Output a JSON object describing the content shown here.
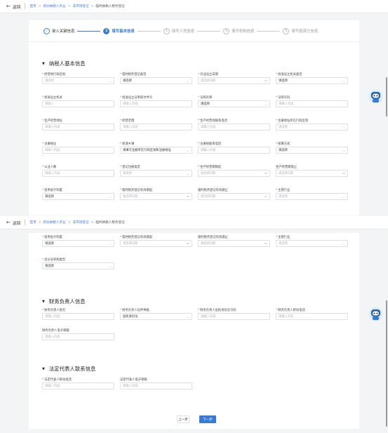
{
  "nav": {
    "back": "返回",
    "crumbs": [
      "首页",
      "新办纳税人开业",
      "非市场登记"
    ],
    "current": "临时纳税人税务登记"
  },
  "steps": [
    {
      "n": "✓",
      "label": "录入关键信息",
      "state": "done"
    },
    {
      "n": "2",
      "label": "填写基本信息",
      "state": "active"
    },
    {
      "n": "3",
      "label": "填写人员信息",
      "state": "todo"
    },
    {
      "n": "4",
      "label": "填写机构信息",
      "state": "todo"
    },
    {
      "n": "5",
      "label": "填写投资方信息",
      "state": "todo"
    }
  ],
  "section1": {
    "title": "纳税人基本信息"
  },
  "fields": [
    {
      "label": "经营地行政区划",
      "req": true,
      "value": "请选择",
      "kind": "select",
      "filled": false
    },
    {
      "label": "临时税务登记类型",
      "req": true,
      "value": "请选择",
      "kind": "select",
      "filled": true
    },
    {
      "label": "开业设立日期",
      "req": true,
      "value": "请选择日期",
      "kind": "date",
      "filled": false
    },
    {
      "label": "批准设立机关类型",
      "req": true,
      "value": "请选择",
      "kind": "select",
      "filled": true
    },
    {
      "label": "批准设立机关",
      "req": true,
      "value": "请输入",
      "kind": "text",
      "filled": false
    },
    {
      "label": "批准设立证明或文件号",
      "req": true,
      "value": "请输入内容",
      "kind": "text",
      "filled": false
    },
    {
      "label": "证照名称",
      "req": true,
      "value": "请选择",
      "kind": "select",
      "filled": true
    },
    {
      "label": "证照号码",
      "req": true,
      "value": "请输入内容",
      "kind": "text",
      "filled": false
    },
    {
      "label": "生产经营地址",
      "req": true,
      "value": "请输入内容",
      "kind": "text",
      "filled": false
    },
    {
      "label": "经营范围",
      "req": true,
      "value": "请输入内容",
      "kind": "text",
      "filled": false
    },
    {
      "label": "生产经营地联系电话",
      "req": true,
      "value": "请输入内容",
      "kind": "text",
      "filled": false
    },
    {
      "label": "注册地址所在行政区划",
      "req": true,
      "value": "请选择",
      "kind": "select",
      "filled": false
    },
    {
      "label": "注册地址",
      "req": true,
      "value": "请输入内容",
      "kind": "text",
      "filled": false
    },
    {
      "label": "街道乡镇",
      "req": true,
      "value": "请填写注册所在行政区划和注册地址",
      "kind": "select",
      "filled": true
    },
    {
      "label": "注册地联系电话",
      "req": true,
      "value": "请输入内容",
      "kind": "text",
      "filled": false
    },
    {
      "label": "核算方式",
      "req": true,
      "value": "请选择",
      "kind": "select",
      "filled": true
    },
    {
      "label": "从业人数",
      "req": true,
      "value": "请输入内容",
      "kind": "text",
      "filled": false
    },
    {
      "label": "登记注册类型",
      "req": true,
      "value": "请选择",
      "kind": "select",
      "filled": false
    },
    {
      "label": "生产经营期限起",
      "req": true,
      "value": "请选择日期",
      "kind": "date",
      "filled": false
    },
    {
      "label": "生产经营期限止",
      "req": false,
      "value": "请选择日期",
      "kind": "date",
      "filled": false
    },
    {
      "label": "适用会计制度",
      "req": true,
      "value": "请选择",
      "kind": "select",
      "filled": true
    },
    {
      "label": "临时税务登记有效期起",
      "req": true,
      "value": "请选择日期",
      "kind": "date",
      "filled": false
    },
    {
      "label": "临时税务登记有效期止",
      "req": false,
      "value": "请选择日期",
      "kind": "date",
      "filled": false
    },
    {
      "label": "主管行业",
      "req": true,
      "value": "请选择",
      "kind": "select",
      "filled": false
    },
    {
      "label": "适用会计制度",
      "req": true,
      "value": "请选择",
      "kind": "select",
      "filled": true
    },
    {
      "label": "临时税务登记有效期起",
      "req": true,
      "value": "请选择日期",
      "kind": "date",
      "filled": false
    },
    {
      "label": "临时税务登记有效期止",
      "req": false,
      "value": "请选择日期",
      "kind": "date",
      "filled": false
    },
    {
      "label": "主管行业",
      "req": true,
      "value": "请选择",
      "kind": "select",
      "filled": false
    },
    {
      "label": "总分支机构类型",
      "req": true,
      "value": "请选择",
      "kind": "select",
      "filled": true
    },
    {
      "label": "财务负责人姓名",
      "req": true,
      "value": "请输入内容",
      "kind": "text",
      "filled": false
    },
    {
      "label": "财务负责人证件种类",
      "req": true,
      "value": "居民身份证",
      "kind": "select",
      "filled": true
    },
    {
      "label": "财务负责人居民身份证号码",
      "req": true,
      "value": "请输入内容",
      "kind": "text",
      "filled": false
    },
    {
      "label": "财务负责人移动电话",
      "req": true,
      "value": "请输入内容",
      "kind": "text",
      "filled": false
    },
    {
      "label": "财务负责人电子邮箱",
      "req": false,
      "value": "请输入内容",
      "kind": "text",
      "filled": false
    },
    {
      "label": "法定代表人移动电话",
      "req": true,
      "value": "请输入内容",
      "kind": "text",
      "filled": false
    },
    {
      "label": "法定代表人电子邮箱",
      "req": false,
      "value": "请输入内容",
      "kind": "text",
      "filled": false
    }
  ],
  "section2": {
    "title": "财务负责人信息"
  },
  "section3": {
    "title": "法定代表人联系信息"
  },
  "buttons": {
    "prev": "上一步",
    "next": "下一步"
  },
  "icons": {
    "calendar": "calendar-icon",
    "chevron": "chevron-down-icon"
  },
  "colors": {
    "accent": "#3a7bd5",
    "required": "#e74c3c"
  }
}
